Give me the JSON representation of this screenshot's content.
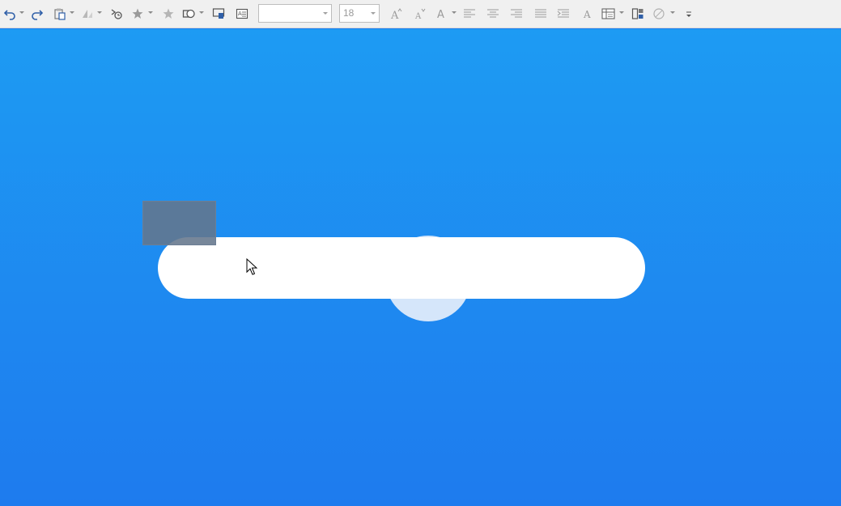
{
  "toolbar": {
    "font_name": "",
    "font_size": "18",
    "icons": [
      "undo-icon",
      "redo-icon",
      "paste-icon",
      "clone-formatting-icon",
      "animation-icon",
      "star-effects-icon",
      "favorites-star-icon",
      "shapes-icon",
      "slideshow-icon",
      "text-box-icon",
      "grow-font-icon",
      "shrink-font-icon",
      "font-color-icon",
      "align-left-icon",
      "align-center-icon",
      "align-right-icon",
      "justify-icon",
      "paragraph-direction-icon",
      "character-icon",
      "table-icon",
      "arrange-icon",
      "shape-effects-icon",
      "more-options-icon"
    ]
  },
  "slide": {
    "background_top": "#1d9bf3",
    "background_bottom": "#1e7bee",
    "pill_color": "#ffffff",
    "circle_color": "#d5e6fa",
    "rect_color": "#64768c"
  }
}
